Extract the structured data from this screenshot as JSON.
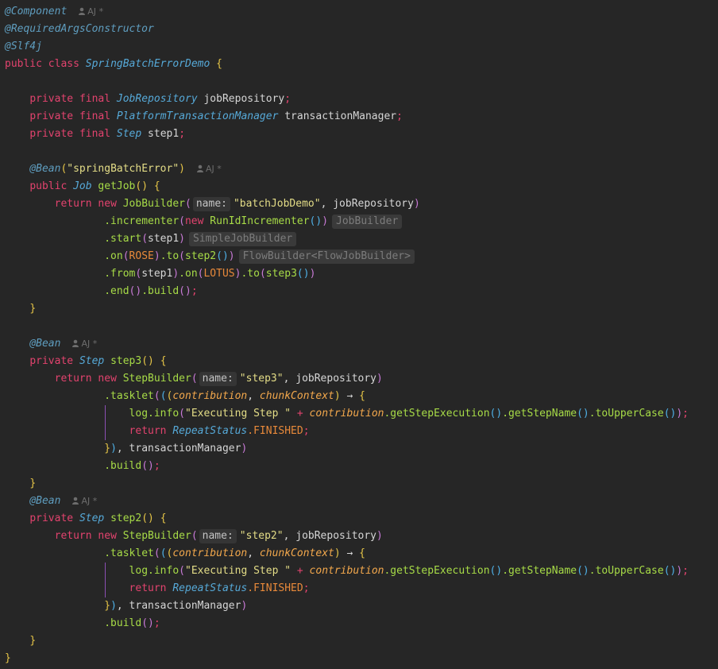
{
  "code": {
    "l1": "@Component",
    "l2": "@RequiredArgsConstructor",
    "l3": "@Slf4j",
    "public": "public",
    "class": "class",
    "class_name": "SpringBatchErrorDemo",
    "private": "private",
    "final": "final",
    "JobRepository": "JobRepository",
    "jobRepository_f": "jobRepository",
    "PlatformTransactionManager": "PlatformTransactionManager",
    "transactionManager_f": "transactionManager",
    "Step": "Step",
    "step1_f": "step1",
    "bean_ann": "@Bean",
    "bean_arg": "\"springBatchError\"",
    "Job": "Job",
    "getJob": "getJob",
    "return": "return",
    "new": "new",
    "JobBuilder": "JobBuilder",
    "name_label": "name:",
    "batchJobDemo": "\"batchJobDemo\"",
    "incrementer": ".incrementer",
    "RunIdIncrementer": "RunIdIncrementer",
    "hint_jobbuilder": "JobBuilder",
    "start": ".start",
    "hint_simplejobbuilder": "SimpleJobBuilder",
    "on": ".on",
    "ROSE": "ROSE",
    "to": ".to",
    "step2_call": "step2",
    "hint_flowbuilder": "FlowBuilder<FlowJobBuilder>",
    "from": ".from",
    "LOTUS": "LOTUS",
    "step3_call": "step3",
    "end": ".end",
    "build": ".build",
    "step3": "step3",
    "StepBuilder": "StepBuilder",
    "step3_str": "\"step3\"",
    "tasklet": ".tasklet",
    "contribution": "contribution",
    "chunkContext": "chunkContext",
    "arrow": "→",
    "log": "log",
    "info": ".info",
    "exec_str": "\"Executing Step \"",
    "plus": "+",
    "getStepExecution": ".getStepExecution",
    "getStepName": ".getStepName",
    "toUpperCase": ".toUpperCase",
    "RepeatStatus": "RepeatStatus",
    "FINISHED": ".FINISHED",
    "step2": "step2",
    "step2_str": "\"step2\""
  },
  "author": "AJ",
  "author_star": "*"
}
